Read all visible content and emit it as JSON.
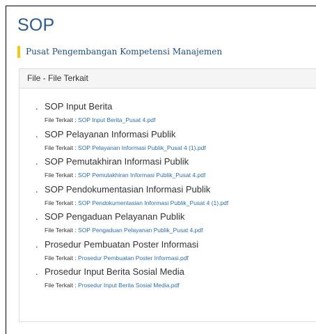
{
  "page": {
    "title": "SOP",
    "subtitle": "Pusat Pengembangan Kompetensi Manajemen",
    "subtitle_accent_color": "#f5c518",
    "title_color": "#2f5b8c",
    "link_color": "#2f6fb0"
  },
  "panel": {
    "heading": "File - File Terkait"
  },
  "documents": [
    {
      "bullet": ".",
      "title": "SOP Input Berita",
      "label": "File Terkait : ",
      "file": "SOP Input Berita_Pusat 4.pdf"
    },
    {
      "bullet": ".",
      "title": "SOP Pelayanan Informasi Publik",
      "label": "File Terkait : ",
      "file": "SOP Pelayanan Informasi Publik_Pusat 4 (1).pdf"
    },
    {
      "bullet": ".",
      "title": "SOP Pemutakhiran Informasi Publik",
      "label": "File Terkait : ",
      "file": "SOP Pemutakhiran Informasi Publik_Pusat 4.pdf"
    },
    {
      "bullet": ".",
      "title": "SOP Pendokumentasian Informasi Publik",
      "label": "File Terkait : ",
      "file": "SOP Pendokumentasian Informasi Publik_Pusat 4 (1).pdf"
    },
    {
      "bullet": ".",
      "title": "SOP Pengaduan Pelayanan Publik",
      "label": "File Terkait : ",
      "file": "SOP Pengaduan Pelayanan Publik_Pusat 4.pdf"
    },
    {
      "bullet": ".",
      "title": "Prosedur Pembuatan Poster Informasi",
      "label": "File Terkait : ",
      "file": "Prosedur Pembuatan Poster Informasi.pdf"
    },
    {
      "bullet": ".",
      "title": "Prosedur Input Berita Sosial Media",
      "label": "File Terkait : ",
      "file": "Prosedur Input Berita Sosial Media.pdf"
    }
  ]
}
